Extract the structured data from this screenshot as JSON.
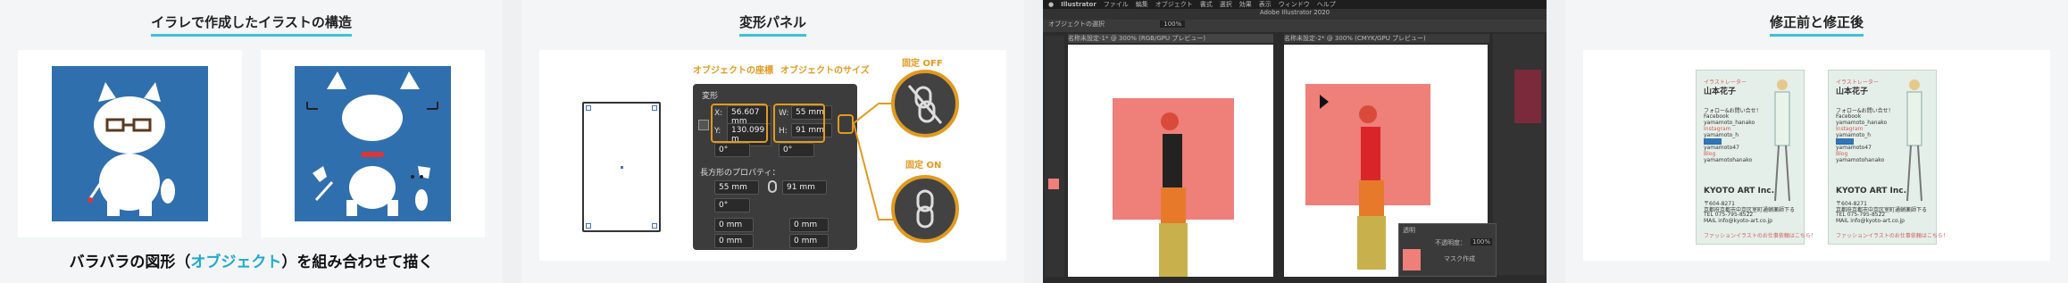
{
  "panels": {
    "illustration": {
      "title": "イラレで作成したイラストの構造",
      "caption_pre": "バラバラの図形（",
      "caption_highlight": "オブジェクト",
      "caption_post": "）を組み合わせて描く",
      "colors": {
        "background": "#2f6fae",
        "accent": "#21a9cf"
      }
    },
    "transform": {
      "title": "変形パネル",
      "label_coords": "オブジェクトの座標",
      "label_size": "オブジェクトのサイズ",
      "label_off": "固定 OFF",
      "label_on": "固定 ON",
      "panel_tab": "変形",
      "x_label": "X:",
      "x_value": "56.607 mm",
      "y_label": "Y:",
      "y_value": "130.099 m",
      "w_label": "W:",
      "w_value": "55 mm",
      "h_label": "H:",
      "h_value": "91 mm",
      "angle1": "0°",
      "angle2": "0°",
      "rect_props": "長方形のプロパティ：",
      "rect_w": "55 mm",
      "rect_h": "91 mm",
      "rect_angle": "0°",
      "corner1": "0 mm",
      "corner2": "0 mm",
      "corner3": "0 mm",
      "corner4": "0 mm",
      "colors": {
        "accent": "#e09a21",
        "panel": "#3c3c3c"
      }
    },
    "illustrator": {
      "menu": [
        "Illustrator",
        "ファイル",
        "編集",
        "オブジェクト",
        "書式",
        "選択",
        "効果",
        "表示",
        "ウィンドウ",
        "ヘルプ"
      ],
      "window_title": "Adobe Illustrator 2020",
      "tab1": "名称未設定-1* @ 300% (RGB/GPU プレビュー)",
      "tab2": "名称未設定-2* @ 300% (CMYK/GPU プレビュー)",
      "toolbar_label": "オブジェクトの選択",
      "zoom": "100%",
      "layer_panel": "透明",
      "opacity": "不透明度：",
      "opacity_value": "100%",
      "mask_label": "マスク作成"
    },
    "before_after": {
      "title": "修正前と修正後",
      "card_before": {
        "job": "イラストレーター",
        "name": "山本花子",
        "lines": [
          "フォロー&お問い合せ！",
          "Facebook",
          "yamamoto_hanako",
          "Instagram",
          "yamamoto_h",
          "Twitter",
          "yamamoto47",
          "Blog",
          "yamamotohanako"
        ],
        "company": "KYOTO ART Inc.",
        "address": [
          "〒604-8271",
          "京都府京都市中京区室町通蛸薬師下る",
          "TEL 075-795-8522",
          "MAIL info@kyoto-art.co.jp"
        ],
        "footer": "ファッションイラストのお仕事依頼はこちら！"
      },
      "card_after": {
        "job": "イラストレーター",
        "name": "山本花子",
        "lines": [
          "フォロー&お問い合せ！",
          "Facebook",
          "yamamoto_hanako",
          "Instagram",
          "yamamoto_h",
          "Twitter",
          "yamamoto47",
          "Blog",
          "yamamotohanako"
        ],
        "company": "KYOTO ART Inc.",
        "address": [
          "〒604-8271",
          "京都府京都市中京区室町通蛸薬師下る",
          "TEL 075-795-8522",
          "MAIL info@kyoto-art.co.jp"
        ],
        "footer": "ファッションイラストのお仕事依頼はこちら！"
      }
    }
  }
}
